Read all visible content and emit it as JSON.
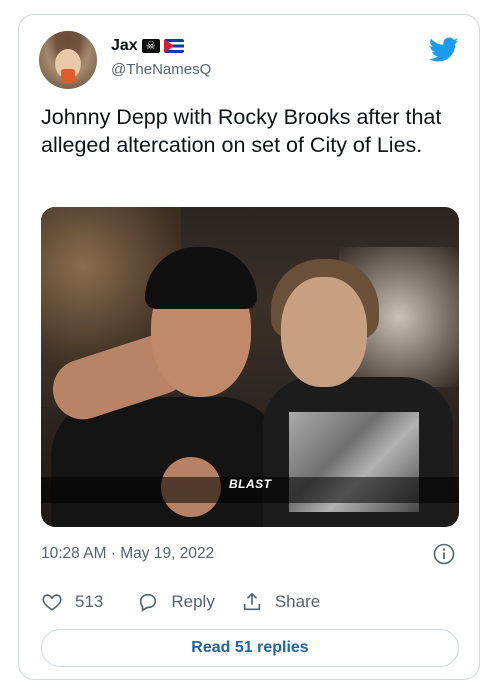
{
  "author": {
    "display_name": "Jax",
    "flag_icons": [
      "pirate-flag-icon",
      "cuba-flag-icon"
    ],
    "handle": "@TheNamesQ"
  },
  "brand": {
    "icon": "twitter-bird-icon",
    "color": "#1d9bf0"
  },
  "tweet": {
    "text": "Johnny Depp with Rocky Brooks after that alleged altercation on set of City of Lies.",
    "image_watermark": "BLAST",
    "timestamp": "10:28 AM · May 19, 2022"
  },
  "actions": {
    "like_count": "513",
    "reply_label": "Reply",
    "share_label": "Share"
  },
  "replies_button": {
    "label": "Read 51 replies"
  },
  "colors": {
    "text": "#0f1419",
    "muted": "#536471",
    "border": "#cfd9de",
    "link": "#1d63a8"
  }
}
